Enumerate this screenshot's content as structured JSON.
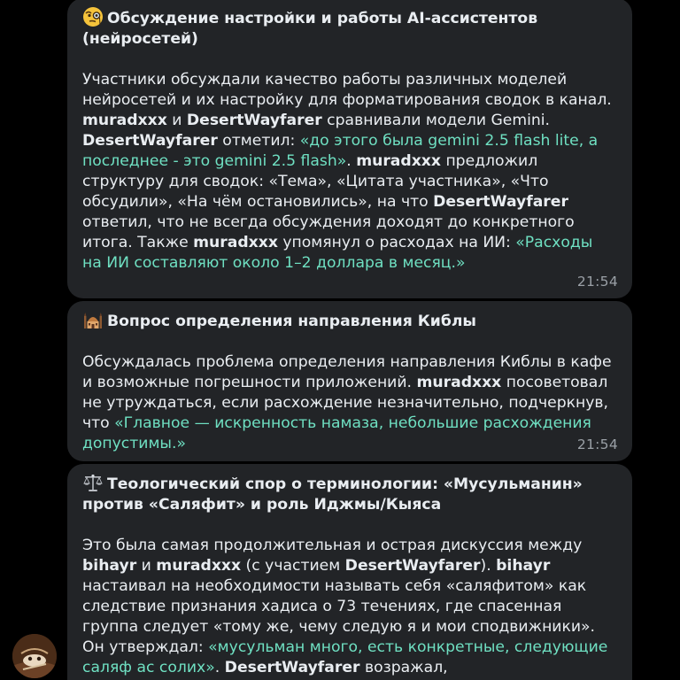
{
  "messages": [
    {
      "emoji": "face-with-monocle",
      "title": "Обсуждение настройки и работы AI-ассистентов (нейросетей)",
      "segments": [
        {
          "t": "Участники обсуждали качество работы различных моделей нейросетей и их настройку для форматирования сводок в канал. ",
          "s": "n"
        },
        {
          "t": "muradxxx",
          "s": "b"
        },
        {
          "t": " и ",
          "s": "n"
        },
        {
          "t": "DesertWayfarer",
          "s": "b"
        },
        {
          "t": " сравнивали модели Gemini. ",
          "s": "n"
        },
        {
          "t": "DesertWayfarer",
          "s": "b"
        },
        {
          "t": " отметил: ",
          "s": "n"
        },
        {
          "t": "«до этого была gemini 2.5 flash lite, а последнее - это gemini 2.5 flash»",
          "s": "q"
        },
        {
          "t": ". ",
          "s": "n"
        },
        {
          "t": "muradxxx",
          "s": "b"
        },
        {
          "t": " предложил структуру для сводок: «Тема», «Цитата участника», «Что обсудили», «На чём остановились», на что ",
          "s": "n"
        },
        {
          "t": "DesertWayfarer",
          "s": "b"
        },
        {
          "t": " ответил, что не всегда обсуждения доходят до конкретного итога. Также ",
          "s": "n"
        },
        {
          "t": "muradxxx",
          "s": "b"
        },
        {
          "t": " упомянул о расходах на ИИ: ",
          "s": "n"
        },
        {
          "t": "«Расходы на ИИ составляют около 1–2 доллара в месяц.»",
          "s": "q"
        }
      ],
      "time": "21:54"
    },
    {
      "emoji": "mosque",
      "title": "Вопрос определения направления Киблы",
      "segments": [
        {
          "t": "Обсуждалась проблема определения направления Киблы в кафе и возможные погрешности приложений. ",
          "s": "n"
        },
        {
          "t": "muradxxx",
          "s": "b"
        },
        {
          "t": " посоветовал не утруждаться, если расхождение незначительно, подчеркнув, что ",
          "s": "n"
        },
        {
          "t": "«Главное — искренность намаза, небольшие расхождения допустимы.»",
          "s": "q"
        }
      ],
      "time": "21:54"
    },
    {
      "emoji": "balance-scale",
      "title": "Теологический спор о терминологии: «Мусульманин» против «Саляфит» и роль Иджмы/Кыяса",
      "segments": [
        {
          "t": "Это была самая продолжительная и острая дискуссия между ",
          "s": "n"
        },
        {
          "t": "bihayr",
          "s": "b"
        },
        {
          "t": " и ",
          "s": "n"
        },
        {
          "t": "muradxxx",
          "s": "b"
        },
        {
          "t": " (с участием ",
          "s": "n"
        },
        {
          "t": "DesertWayfarer",
          "s": "b"
        },
        {
          "t": "). ",
          "s": "n"
        },
        {
          "t": "bihayr",
          "s": "b"
        },
        {
          "t": " настаивал на необходимости называть себя «саляфитом» как следствие признания хадиса о 73 течениях, где спасенная группа следует «тому же, чему следую я и мои сподвижники». Он утверждал: ",
          "s": "n"
        },
        {
          "t": "«мусульман много, есть конкретные, следующие саляф ас солих»",
          "s": "q"
        },
        {
          "t": ". ",
          "s": "n"
        },
        {
          "t": "DesertWayfarer",
          "s": "b"
        },
        {
          "t": " возражал,",
          "s": "n"
        }
      ],
      "time": ""
    }
  ],
  "avatar": {
    "icon": "user-avatar"
  },
  "colors": {
    "background": "#000000",
    "bubble": "#222427",
    "text": "#e9edf1",
    "quote": "#6fe0c2",
    "time": "#9aa0a6"
  }
}
